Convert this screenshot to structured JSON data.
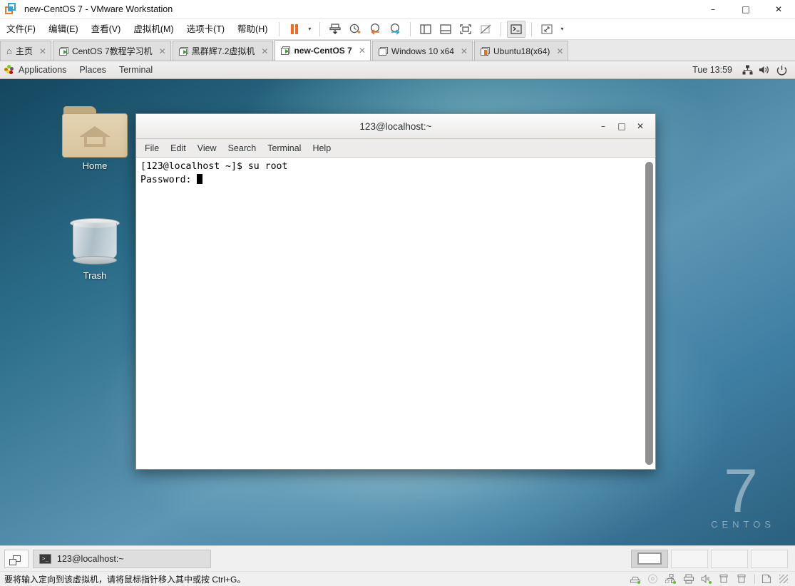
{
  "window": {
    "title": "new-CentOS 7 - VMware Workstation",
    "app_icon": "vmware-icon",
    "minimize": "–",
    "maximize": "□",
    "close": "✕"
  },
  "menubar": {
    "items": [
      {
        "label": "文件(F)",
        "name": "menu-file"
      },
      {
        "label": "编辑(E)",
        "name": "menu-edit"
      },
      {
        "label": "查看(V)",
        "name": "menu-view"
      },
      {
        "label": "虚拟机(M)",
        "name": "menu-vm"
      },
      {
        "label": "选项卡(T)",
        "name": "menu-tabs"
      },
      {
        "label": "帮助(H)",
        "name": "menu-help"
      }
    ]
  },
  "toolbar": {
    "caret": "▾",
    "buttons": [
      {
        "name": "suspend-button",
        "icon": "pause-icon"
      },
      {
        "name": "suspend-dropdown",
        "icon": "chevron-down-icon"
      },
      {
        "name": "snapshot-button",
        "icon": "snapshot-icon"
      },
      {
        "name": "take-snapshot-button",
        "icon": "clock-plus-icon"
      },
      {
        "name": "revert-snapshot-button",
        "icon": "clock-back-icon"
      },
      {
        "name": "snapshot-manager-button",
        "icon": "clock-manage-icon"
      },
      {
        "name": "show-sidebar-button",
        "icon": "panel-left-icon"
      },
      {
        "name": "show-thumbnail-bar-button",
        "icon": "panel-bottom-icon"
      },
      {
        "name": "fullscreen-button",
        "icon": "fullscreen-icon"
      },
      {
        "name": "unity-mode-button",
        "icon": "unity-off-icon"
      },
      {
        "name": "console-view-button",
        "icon": "terminal-icon"
      },
      {
        "name": "stretch-guest-button",
        "icon": "expand-arrows-icon"
      },
      {
        "name": "stretch-dropdown",
        "icon": "chevron-down-icon"
      }
    ]
  },
  "tabs": [
    {
      "label": "主页",
      "icon": "home-icon",
      "state": "home",
      "active": false,
      "close": "✕"
    },
    {
      "label": "CentOS 7教程学习机",
      "icon": "vm-running-icon",
      "state": "running",
      "active": false,
      "close": "✕"
    },
    {
      "label": "黑群辉7.2虚拟机",
      "icon": "vm-running-icon",
      "state": "running",
      "active": false,
      "close": "✕"
    },
    {
      "label": "new-CentOS 7",
      "icon": "vm-running-icon",
      "state": "running",
      "active": true,
      "close": "✕"
    },
    {
      "label": "Windows 10 x64",
      "icon": "vm-poweroff-icon",
      "state": "off",
      "active": false,
      "close": "✕"
    },
    {
      "label": "Ubuntu18(x64)",
      "icon": "vm-suspended-icon",
      "state": "suspended",
      "active": false,
      "close": "✕"
    }
  ],
  "guest": {
    "panel": {
      "applications": "Applications",
      "places": "Places",
      "terminal": "Terminal",
      "clock": "Tue 13:59",
      "tray": [
        {
          "name": "network-icon",
          "glyph": "⚘"
        },
        {
          "name": "volume-icon",
          "glyph": "ὐa"
        },
        {
          "name": "power-icon",
          "glyph": "⏻"
        }
      ]
    },
    "desktop_icons": [
      {
        "label": "Home",
        "name": "desktop-icon-home"
      },
      {
        "label": "Trash",
        "name": "desktop-icon-trash"
      }
    ],
    "watermark": {
      "number": "7",
      "word": "CENTOS"
    },
    "terminal": {
      "title": "123@localhost:~",
      "minimize": "–",
      "maximize": "□",
      "close": "✕",
      "menus": [
        "File",
        "Edit",
        "View",
        "Search",
        "Terminal",
        "Help"
      ],
      "lines": [
        "[123@localhost ~]$ su root",
        "Password: "
      ]
    }
  },
  "taskbar": {
    "show-desktop": "show-desktop-button",
    "item_label": "123@localhost:~"
  },
  "statusbar": {
    "message": "要将输入定向到该虚拟机，请将鼠标指针移入其中或按 Ctrl+G。",
    "devices": [
      {
        "name": "harddisk-icon"
      },
      {
        "name": "cdrom-icon"
      },
      {
        "name": "network-adapter-icon"
      },
      {
        "name": "printer-icon"
      },
      {
        "name": "sound-icon"
      },
      {
        "name": "usb-icon"
      },
      {
        "name": "usb2-icon"
      },
      {
        "name": "display-icon"
      }
    ]
  },
  "colors": {
    "accent_orange": "#ef6c22",
    "accent_blue": "#2aa3df",
    "running_green": "#3b9c35",
    "desktop_dark": "#14465f",
    "desktop_light": "#5d96b4"
  }
}
